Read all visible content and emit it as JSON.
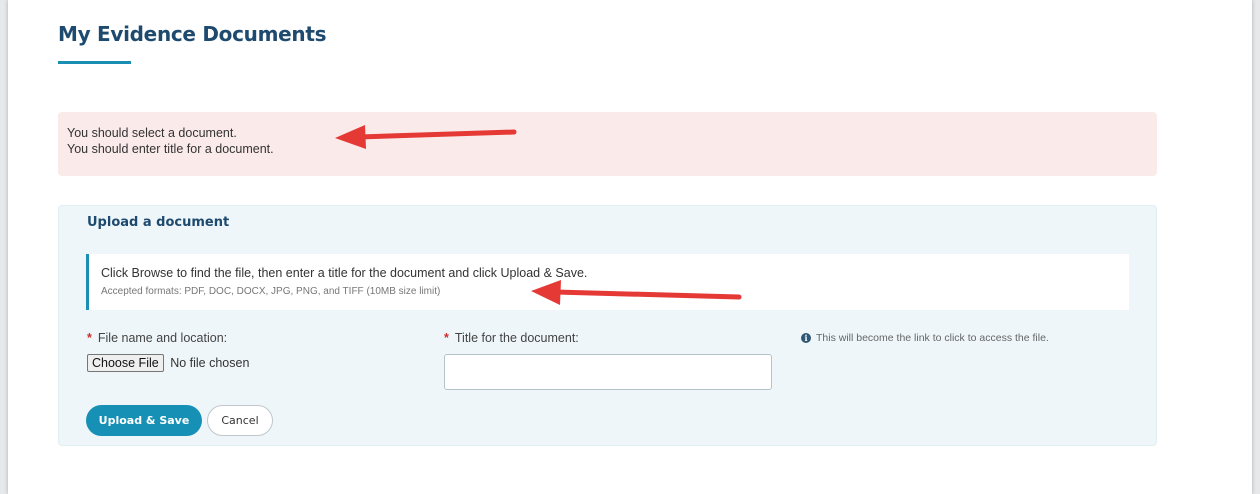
{
  "page": {
    "title": "My Evidence Documents"
  },
  "alert": {
    "messages": [
      "You should select a document.",
      "You should enter title for a document."
    ]
  },
  "upload": {
    "heading": "Upload a document",
    "instructions": "Click Browse to find the file, then enter a title for the document and click Upload & Save.",
    "formats": "Accepted formats: PDF, DOC, DOCX, JPG, PNG, and TIFF (10MB size limit)",
    "file_label": "File name and location:",
    "title_label": "Title for the document:",
    "required_mark": "*",
    "hint": "This will become the link to click to access the file.",
    "choose_file_label": "Choose File",
    "no_file_text": "No file chosen",
    "title_value": "",
    "upload_button": "Upload & Save",
    "cancel_button": "Cancel"
  },
  "icons": {
    "info": "info-circle-icon",
    "annotation": "red-arrow"
  },
  "colors": {
    "accent": "#1691b5",
    "heading": "#1d4a6e",
    "alert_bg": "#fbeaea",
    "panel_bg": "#eef6f9",
    "required": "#c9302c",
    "arrow": "#e53935"
  }
}
